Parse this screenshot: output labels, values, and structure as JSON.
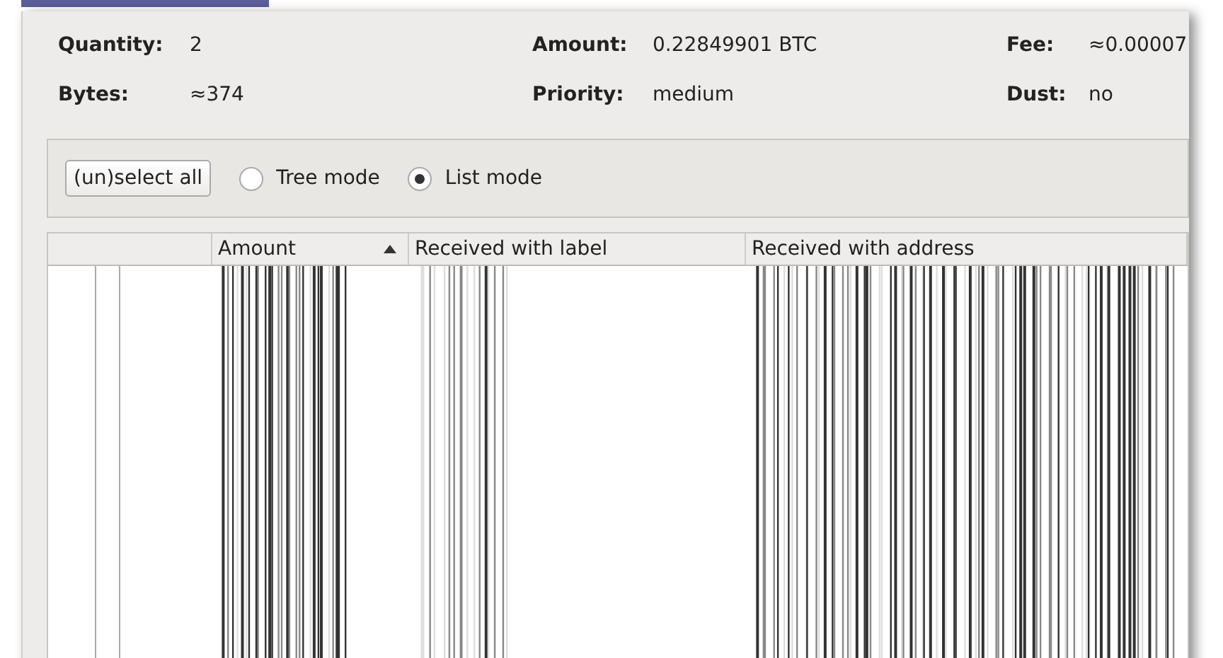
{
  "summary": [
    {
      "label": "Quantity:",
      "value": "2"
    },
    {
      "label": "Amount:",
      "value": "0.22849901 BTC"
    },
    {
      "label": "Fee:",
      "value": "≈0.00007"
    },
    {
      "label": "Bytes:",
      "value": "≈374"
    },
    {
      "label": "Priority:",
      "value": "medium"
    },
    {
      "label": "Dust:",
      "value": "no"
    }
  ],
  "toolbar": {
    "button": "(un)select all",
    "modes": [
      {
        "label": "Tree mode",
        "selected": false
      },
      {
        "label": "List mode",
        "selected": true
      }
    ]
  },
  "table": {
    "columns": [
      {
        "label": "Amount",
        "sorted": true
      },
      {
        "label": "Received with label",
        "sorted": false
      },
      {
        "label": "Received with address",
        "sorted": false
      }
    ]
  }
}
